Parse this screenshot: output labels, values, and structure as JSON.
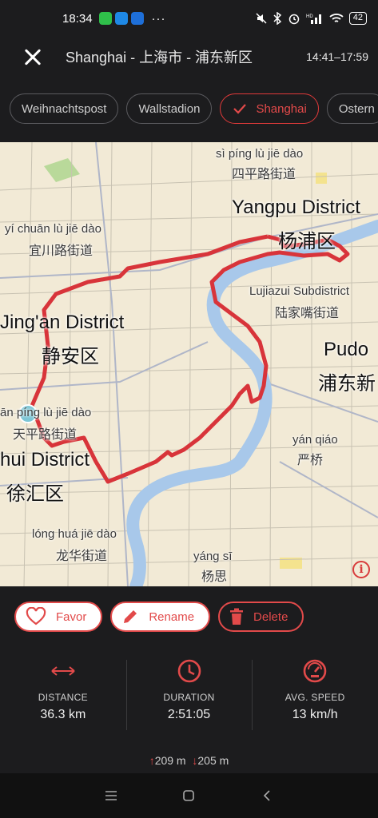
{
  "status_bar": {
    "time": "18:34",
    "apps": [
      "wechat-icon",
      "app-icon",
      "app-icon"
    ],
    "dots": "···",
    "battery": "42"
  },
  "header": {
    "title": "Shanghai - 上海市 - 浦东新区",
    "time_range": "14:41–17:59"
  },
  "chips": [
    {
      "label": "Weihnachtspost",
      "active": false
    },
    {
      "label": "Wallstadion",
      "active": false
    },
    {
      "label": "Shanghai",
      "active": true
    },
    {
      "label": "Ostern",
      "active": false
    }
  ],
  "map": {
    "labels": {
      "siping_py": "sì píng lù jiē dào",
      "siping_cn": "四平路街道",
      "yangpu_en": "Yangpu District",
      "yangpu_cn": "杨浦区",
      "yichuan_py": "yí chuān lù jiē dào",
      "yichuan_cn": "宜川路街道",
      "lujiazui_en": "Lujiazui Subdistrict",
      "lujiazui_cn": "陆家嘴街道",
      "jingan_en": "Jing'an District",
      "jingan_cn": "静安区",
      "pudong_en": "Pudo",
      "pudong_cn": "浦东新",
      "tianping_py": "ān píng lù jiē dào",
      "tianping_cn": "天平路街道",
      "xuhui_en": "hui District",
      "xuhui_cn": "徐汇区",
      "yanqiao_py": "yán qiáo",
      "yanqiao_cn": "严桥",
      "longhua_py": "lóng huá jiē dào",
      "longhua_cn": "龙华街道",
      "yangsi_py": "yáng sī",
      "yangsi_cn": "杨思"
    },
    "route_color": "#d8343a",
    "river_color": "#a8c8ea"
  },
  "actions": {
    "favor": "Favor",
    "rename": "Rename",
    "delete": "Delete"
  },
  "stats": {
    "distance_label": "DISTANCE",
    "distance_value": "36.3 km",
    "duration_label": "DURATION",
    "duration_value": "2:51:05",
    "speed_label": "AVG. SPEED",
    "speed_value": "13 km/h"
  },
  "elevation": {
    "up": "209 m",
    "down": "205 m"
  },
  "accent_color": "#e24a4a"
}
